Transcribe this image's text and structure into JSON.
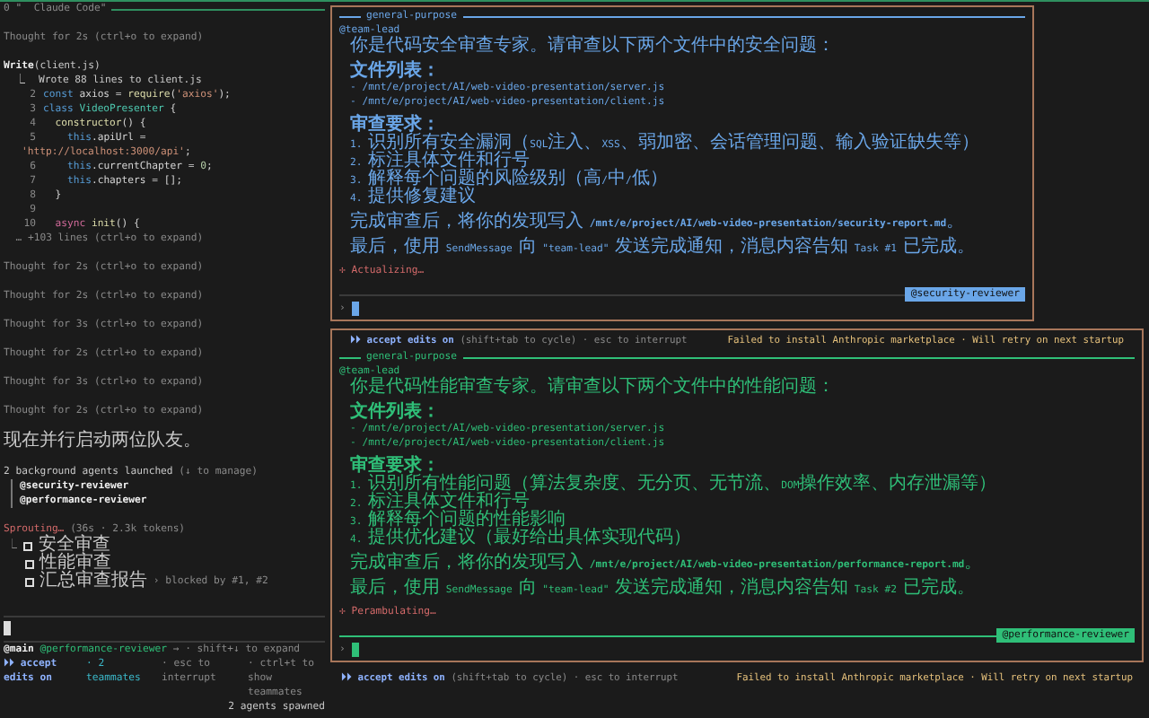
{
  "left_pane": {
    "title": "0 \"  Claude Code\"",
    "transcript": [
      {
        "kind": "thought",
        "text": "Thought for 2s (ctrl+o to expand)"
      },
      {
        "kind": "tool",
        "name": "Write",
        "arg": "(client.js)",
        "result": "⎿  Wrote 88 lines to client.js",
        "code": [
          {
            "num": "2",
            "segments": [
              {
                "kind": "kw",
                "text": "const"
              },
              {
                "kind": "plain",
                "text": " axios = "
              },
              {
                "kind": "fn",
                "text": "require"
              },
              {
                "kind": "plain",
                "text": "("
              },
              {
                "kind": "str",
                "text": "'axios'"
              },
              {
                "kind": "plain",
                "text": ");"
              }
            ]
          },
          {
            "num": "3",
            "segments": [
              {
                "kind": "kw",
                "text": "class"
              },
              {
                "kind": "cls",
                "text": " VideoPresenter"
              },
              {
                "kind": "plain",
                "text": " {"
              }
            ]
          },
          {
            "num": "4",
            "segments": [
              {
                "kind": "fn",
                "text": "  constructor"
              },
              {
                "kind": "plain",
                "text": "() {"
              }
            ]
          },
          {
            "num": "5",
            "segments": [
              {
                "kind": "kw",
                "text": "    this"
              },
              {
                "kind": "plain",
                "text": ".apiUrl ="
              }
            ]
          },
          {
            "segments": [
              {
                "kind": "str",
                "text": "'http://localhost:3000/api'"
              },
              {
                "kind": "plain",
                "text": ";"
              }
            ]
          },
          {
            "num": "6",
            "segments": [
              {
                "kind": "kw",
                "text": "    this"
              },
              {
                "kind": "plain",
                "text": ".currentChapter = "
              },
              {
                "kind": "num",
                "text": "0"
              },
              {
                "kind": "plain",
                "text": ";"
              }
            ]
          },
          {
            "num": "7",
            "segments": [
              {
                "kind": "kw",
                "text": "    this"
              },
              {
                "kind": "plain",
                "text": ".chapters = [];"
              }
            ]
          },
          {
            "num": "8",
            "segments": [
              {
                "kind": "plain",
                "text": "  }"
              }
            ]
          },
          {
            "num": "9"
          },
          {
            "num": "10",
            "segments": [
              {
                "kind": "async",
                "text": "  async"
              },
              {
                "kind": "fn",
                "text": " init"
              },
              {
                "kind": "plain",
                "text": "() {"
              }
            ]
          }
        ],
        "more": "… +103 lines (ctrl+o to expand)"
      },
      {
        "kind": "thought",
        "text": "Thought for 2s (ctrl+o to expand)"
      },
      {
        "kind": "thought",
        "text": "Thought for 2s (ctrl+o to expand)"
      },
      {
        "kind": "thought",
        "text": "Thought for 3s (ctrl+o to expand)"
      },
      {
        "kind": "thought",
        "text": "Thought for 2s (ctrl+o to expand)"
      },
      {
        "kind": "thought",
        "text": "Thought for 3s (ctrl+o to expand)"
      },
      {
        "kind": "thought",
        "text": "Thought for 2s (ctrl+o to expand)"
      },
      {
        "kind": "text",
        "text": "现在并行启动两位队友。"
      },
      {
        "kind": "agents",
        "summary": "2 background agents launched",
        "hint": "(↓ to manage)",
        "agents": [
          "@security-reviewer",
          "@performance-reviewer"
        ]
      },
      {
        "kind": "tasks",
        "status": "Sprouting…",
        "meta": "(36s · 2.3k tokens)",
        "corner": "⎿",
        "tasks": [
          {
            "label": "安全审查",
            "checked": false
          },
          {
            "label": "性能审查",
            "checked": false
          },
          {
            "label": "汇总审查报告",
            "checked": false,
            "note": "› blocked by #1, #2"
          }
        ]
      }
    ],
    "mention": {
      "main": "@main",
      "agent": "@performance-reviewer",
      "hint": "→ · shift+↓ to expand"
    },
    "status_items": [
      {
        "kind": "mode",
        "text": "⏵⏵ accept edits on"
      },
      {
        "kind": "teammates",
        "text": "· 2 teammates"
      },
      {
        "kind": "hint",
        "text": "· esc to interrupt"
      },
      {
        "kind": "hint",
        "text": "· ctrl+t to show teammates"
      }
    ],
    "spawned": "2 agents spawned"
  },
  "agent_panes": [
    {
      "header": "general-purpose",
      "sender": "@team-lead",
      "color": "#6aa6e8",
      "intro": "你是代码安全审查专家。请审查以下两个文件中的安全问题：",
      "files_heading": "文件列表：",
      "files": [
        "- /mnt/e/project/AI/web-video-presentation/server.js",
        "- /mnt/e/project/AI/web-video-presentation/client.js"
      ],
      "requirements_heading": "审查要求：",
      "requirements": [
        "1. 识别所有安全漏洞（SQL注入、XSS、弱加密、会话管理问题、输入验证缺失等）",
        "2. 标注具体文件和行号",
        "3. 解释每个问题的风险级别（高/中/低）",
        "4. 提供修复建议"
      ],
      "report": "完成审查后，将你的发现写入 **/mnt/e/project/AI/web-video-presentation/security-report.md**。",
      "final": "最后，使用 SendMessage 向 \"team-lead\" 发送完成通知，消息内容告知 Task #1 已完成。",
      "spinner": "✢ Actualizing…",
      "prompt": "›",
      "tag": "@security-reviewer"
    },
    {
      "status": {
        "mode": "⏵⏵ accept edits on",
        "hint": "(shift+tab to cycle) · esc to interrupt",
        "warning": "Failed to install Anthropic marketplace · Will retry on next startup"
      },
      "header": "general-purpose",
      "sender": "@team-lead",
      "color": "#2fbf78",
      "intro": "你是代码性能审查专家。请审查以下两个文件中的性能问题：",
      "files_heading": "文件列表：",
      "files": [
        "- /mnt/e/project/AI/web-video-presentation/server.js",
        "- /mnt/e/project/AI/web-video-presentation/client.js"
      ],
      "requirements_heading": "审查要求：",
      "requirements": [
        "1. 识别所有性能问题（算法复杂度、无分页、无节流、DOM操作效率、内存泄漏等）",
        "2. 标注具体文件和行号",
        "3. 解释每个问题的性能影响",
        "4. 提供优化建议（最好给出具体实现代码）"
      ],
      "report": "完成审查后，将你的发现写入 **/mnt/e/project/AI/web-video-presentation/performance-report.md**。",
      "final": "最后，使用 SendMessage 向 \"team-lead\" 发送完成通知，消息内容告知 Task #2 已完成。",
      "spinner": "✢ Perambulating…",
      "prompt": "›",
      "tag": "@performance-reviewer"
    }
  ],
  "status_bar": {
    "mode": "⏵⏵ accept edits on",
    "hint": "(shift+tab to cycle) · esc to interrupt",
    "warning": "Failed to install Anthropic marketplace · Will retry on next startup"
  }
}
